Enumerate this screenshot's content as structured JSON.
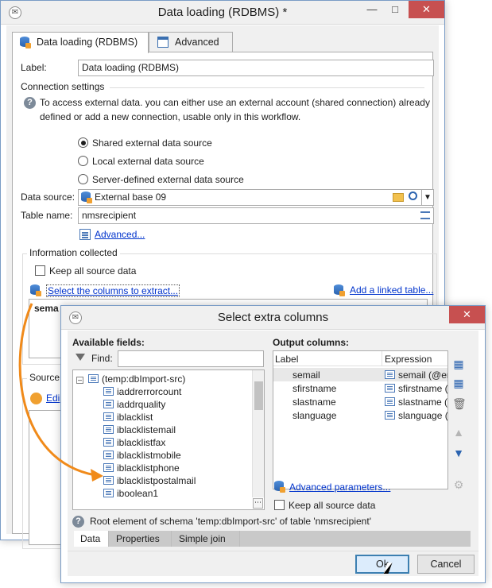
{
  "main_window": {
    "title": "Data loading (RDBMS) *",
    "tabs": [
      {
        "label": "Data loading (RDBMS)"
      },
      {
        "label": "Advanced"
      }
    ],
    "label_caption": "Label:",
    "label_value": "Data loading (RDBMS)",
    "connection_settings": "Connection settings",
    "help_text_line1": "To access external data. you can either use an external account (shared connection) already",
    "help_text_line2": "defined or add a new connection, usable only in this",
    "help_text_line2_tail": "workflow.",
    "radio_options": [
      {
        "label": "Shared external data source",
        "selected": true
      },
      {
        "label": "Local external data source",
        "selected": false
      },
      {
        "label": "Server-defined external data source",
        "selected": false
      }
    ],
    "data_source_label": "Data source:",
    "data_source_value": "External base 09",
    "table_name_label": "Table name:",
    "table_name_value": "nmsrecipient",
    "advanced_link": "Advanced...",
    "information_collected": "Information collected",
    "keep_all_source_data": "Keep all source data",
    "select_columns_link": "Select the columns to extract...",
    "add_linked_table_link": "Add a linked table...",
    "grid_partial_text": "sema",
    "source_partial": "Source",
    "edit_partial_link": "Edi"
  },
  "extra_dialog": {
    "title": "Select extra columns",
    "available_fields_label": "Available fields:",
    "find_label": "Find:",
    "find_value": "",
    "tree_root": "(temp:dbImport-src)",
    "fields": [
      "iaddrerrorcount",
      "iaddrquality",
      "iblacklist",
      "iblacklistemail",
      "iblacklistfax",
      "iblacklistmobile",
      "iblacklistphone",
      "iblacklistpostalmail",
      "iboolean1"
    ],
    "output_columns_label": "Output columns:",
    "col_label_header": "Label",
    "col_expr_header": "Expression",
    "output_rows": [
      {
        "label": "semail",
        "expression": "semail (@en"
      },
      {
        "label": "sfirstname",
        "expression": "sfirstname ("
      },
      {
        "label": "slastname",
        "expression": "slastname (@"
      },
      {
        "label": "slanguage",
        "expression": "slanguage (@"
      }
    ],
    "advanced_parameters_link": "Advanced parameters...",
    "keep_all_source_data": "Keep all source data",
    "status_text": "Root element of schema 'temp:dbImport-src' of table 'nmsrecipient'",
    "bottom_tabs": [
      "Data",
      "Properties",
      "Simple join"
    ],
    "ok_label": "Ok",
    "cancel_label": "Cancel"
  }
}
